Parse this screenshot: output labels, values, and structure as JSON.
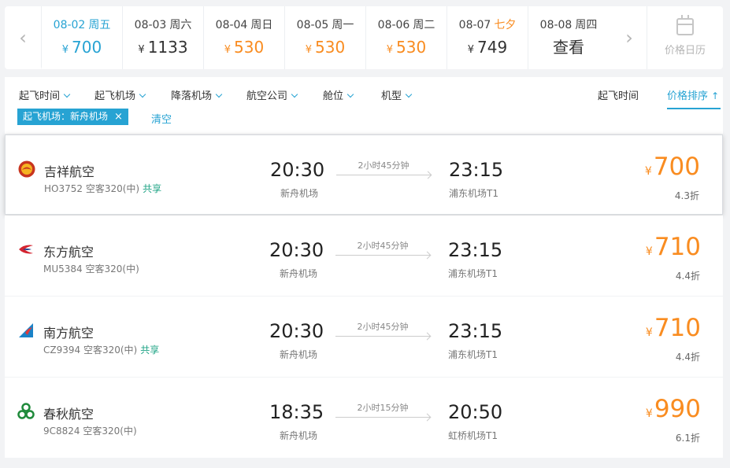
{
  "date_bar": {
    "prev_icon": "chevron-left-icon",
    "next_icon": "chevron-right-icon",
    "dates": [
      {
        "date": "08-02",
        "weekday": "周五",
        "currency": "¥",
        "price": "700",
        "style": "selected"
      },
      {
        "date": "08-03",
        "weekday": "周六",
        "currency": "¥",
        "price": "1133",
        "style": "normal"
      },
      {
        "date": "08-04",
        "weekday": "周日",
        "currency": "¥",
        "price": "530",
        "style": "orange"
      },
      {
        "date": "08-05",
        "weekday": "周一",
        "currency": "¥",
        "price": "530",
        "style": "orange"
      },
      {
        "date": "08-06",
        "weekday": "周二",
        "currency": "¥",
        "price": "530",
        "style": "orange"
      },
      {
        "date": "08-07",
        "weekday": "七夕",
        "currency": "¥",
        "price": "749",
        "style": "normal",
        "weekday_highlight": true
      },
      {
        "date": "08-08",
        "weekday": "周四",
        "currency": "",
        "price": "查看",
        "style": "normal"
      }
    ],
    "calendar": {
      "icon": "calendar-icon",
      "label": "价格日历"
    }
  },
  "filters": {
    "items": [
      "起飞时间",
      "起飞机场",
      "降落机场",
      "航空公司",
      "舱位",
      "机型"
    ],
    "sort_items": [
      {
        "label": "起飞时间",
        "active": false
      },
      {
        "label": "价格排序",
        "active": true
      }
    ],
    "active_tag": {
      "label": "起飞机场：新舟机场",
      "close": "×"
    },
    "clear_label": "清空"
  },
  "flights": [
    {
      "airline": "吉祥航空",
      "logo": "juneyao-logo-icon",
      "logo_color": "#c8351f",
      "flight_no": "HO3752",
      "aircraft": "空客320(中)",
      "share": "共享",
      "dep_time": "20:30",
      "dep_airport": "新舟机场",
      "duration": "2小时45分钟",
      "arr_time": "23:15",
      "arr_airport": "浦东机场T1",
      "currency": "¥",
      "price": "700",
      "discount": "4.3折"
    },
    {
      "airline": "东方航空",
      "logo": "china-eastern-logo-icon",
      "logo_color": "#d42430",
      "flight_no": "MU5384",
      "aircraft": "空客320(中)",
      "share": "",
      "dep_time": "20:30",
      "dep_airport": "新舟机场",
      "duration": "2小时45分钟",
      "arr_time": "23:15",
      "arr_airport": "浦东机场T1",
      "currency": "¥",
      "price": "710",
      "discount": "4.4折"
    },
    {
      "airline": "南方航空",
      "logo": "china-southern-logo-icon",
      "logo_color": "#1a82c7",
      "flight_no": "CZ9394",
      "aircraft": "空客320(中)",
      "share": "共享",
      "dep_time": "20:30",
      "dep_airport": "新舟机场",
      "duration": "2小时45分钟",
      "arr_time": "23:15",
      "arr_airport": "浦东机场T1",
      "currency": "¥",
      "price": "710",
      "discount": "4.4折"
    },
    {
      "airline": "春秋航空",
      "logo": "spring-airlines-logo-icon",
      "logo_color": "#1f8a3b",
      "flight_no": "9C8824",
      "aircraft": "空客320(中)",
      "share": "",
      "dep_time": "18:35",
      "dep_airport": "新舟机场",
      "duration": "2小时15分钟",
      "arr_time": "20:50",
      "arr_airport": "虹桥机场T1",
      "currency": "¥",
      "price": "990",
      "discount": "6.1折"
    }
  ],
  "colors": {
    "accent": "#27a3d3",
    "price": "#f98c20",
    "share": "#20a486"
  }
}
